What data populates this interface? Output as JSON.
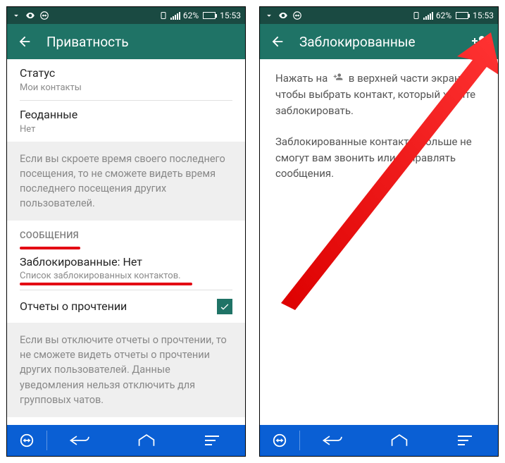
{
  "status": {
    "battery": "62%",
    "time": "15:53"
  },
  "left": {
    "title": "Приватность",
    "status_label": "Статус",
    "status_value": "Мои контакты",
    "geo_label": "Геоданные",
    "geo_value": "Нет",
    "lastseen_info": "Если вы скроете время своего последнего посещения, то не сможете видеть время последнего посещения других пользователей.",
    "section_messages": "СООБЩЕНИЯ",
    "blocked_title": "Заблокированные: Нет",
    "blocked_sub": "Список заблокированных контактов.",
    "read_receipts": "Отчеты о прочтении",
    "read_info": "Если вы отключите отчеты о прочтении, то не сможете видеть отчеты о прочтении других пользователей. Данные уведомления нельзя отключить для групповых чатов."
  },
  "right": {
    "title": "Заблокированные",
    "p1a": "Нажать на",
    "p1b": "в верхней части экрана, чтобы выбрать контакт, который хотите заблокировать.",
    "p2": "Заблокированные контакты больше не смогут вам звонить или отправлять сообщения."
  }
}
